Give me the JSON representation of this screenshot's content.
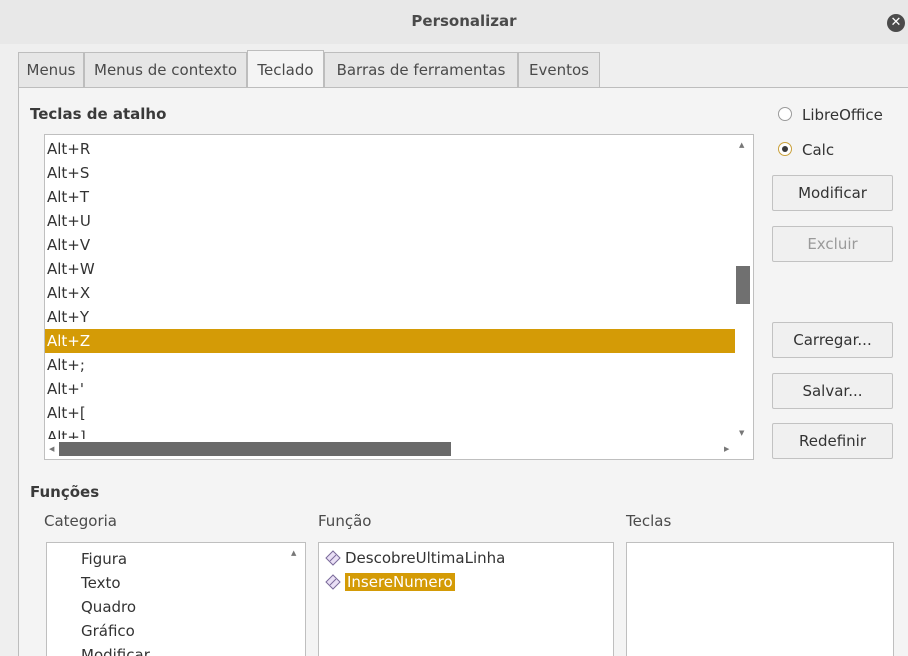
{
  "window": {
    "title": "Personalizar",
    "close_icon": "close-icon"
  },
  "tabs": [
    {
      "label": "Menus"
    },
    {
      "label": "Menus de contexto"
    },
    {
      "label": "Teclado",
      "active": true
    },
    {
      "label": "Barras de ferramentas"
    },
    {
      "label": "Eventos"
    }
  ],
  "shortcuts": {
    "title": "Teclas de atalho",
    "items": [
      "Alt+R",
      "Alt+S",
      "Alt+T",
      "Alt+U",
      "Alt+V",
      "Alt+W",
      "Alt+X",
      "Alt+Y",
      "Alt+Z",
      "Alt+;",
      "Alt+'",
      "Alt+[",
      "Alt+]"
    ],
    "selected": "Alt+Z"
  },
  "scope": {
    "options": [
      {
        "label": "LibreOffice",
        "checked": false
      },
      {
        "label": "Calc",
        "checked": true
      }
    ]
  },
  "buttons": {
    "modify": "Modificar",
    "delete": "Excluir",
    "load": "Carregar...",
    "save": "Salvar...",
    "reset": "Redefinir"
  },
  "functions": {
    "title": "Funções",
    "category_label": "Categoria",
    "function_label": "Função",
    "keys_label": "Teclas",
    "categories": [
      "Figura",
      "Texto",
      "Quadro",
      "Gráfico",
      "Modificar"
    ],
    "function_items": [
      "DescobreUltimaLinha",
      "InsereNumero"
    ],
    "selected_function": "InsereNumero",
    "function_icon": "macro-icon"
  },
  "colors": {
    "selection": "#d49b06",
    "background": "#efefef"
  }
}
